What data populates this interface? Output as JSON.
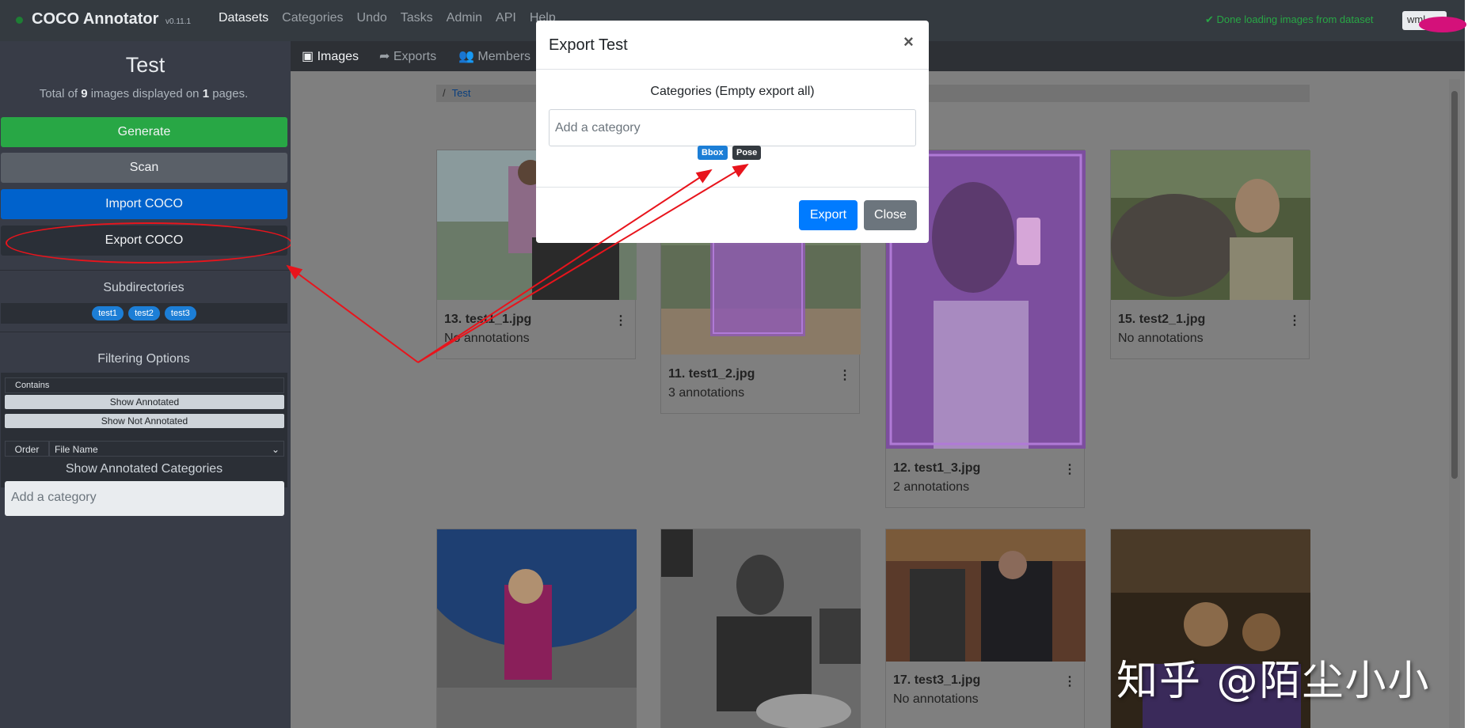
{
  "navbar": {
    "brand": "COCO Annotator",
    "version": "v0.11.1",
    "links": [
      "Datasets",
      "Categories",
      "Undo",
      "Tasks",
      "Admin",
      "API",
      "Help"
    ],
    "status": "Done loading images from dataset",
    "user": "wml"
  },
  "sidebar": {
    "title": "Test",
    "summary_prefix": "Total of ",
    "image_count": "9",
    "summary_mid": " images displayed on ",
    "page_count": "1",
    "summary_suffix": " pages.",
    "generate_label": "Generate",
    "scan_label": "Scan",
    "import_label": "Import COCO",
    "export_label": "Export COCO",
    "subdirectories_heading": "Subdirectories",
    "subdirectories": [
      "test1",
      "test2",
      "test3"
    ],
    "filtering_heading": "Filtering Options",
    "contains_label": "Contains",
    "show_annotated_label": "Show Annotated",
    "show_not_annotated_label": "Show Not Annotated",
    "order_label": "Order",
    "order_value": "File Name",
    "annotated_categories_heading": "Show Annotated Categories",
    "category_placeholder": "Add a category"
  },
  "tabs": [
    "Images",
    "Exports",
    "Members"
  ],
  "breadcrumb": {
    "separator": "/",
    "item": "Test"
  },
  "cards": [
    {
      "name": "13. test1_1.jpg",
      "annotations": "No annotations"
    },
    {
      "name": "11. test1_2.jpg",
      "annotations": "3 annotations"
    },
    {
      "name": "12. test1_3.jpg",
      "annotations": "2 annotations"
    },
    {
      "name": "15. test2_1.jpg",
      "annotations": "No annotations"
    },
    {
      "name": "17. test3_1.jpg",
      "annotations": "No annotations"
    }
  ],
  "modal": {
    "title": "Export Test",
    "close_symbol": "×",
    "categories_label": "Categories (Empty export all)",
    "category_placeholder": "Add a category",
    "tags": [
      "Bbox",
      "Pose"
    ],
    "export_label": "Export",
    "close_label": "Close"
  },
  "watermark": "知乎 @陌尘小小",
  "colors": {
    "accent_blue": "#007bff",
    "generate_green": "#28a745",
    "annotation_red": "#e8141c",
    "overlay_purple": "#9b59c8"
  }
}
